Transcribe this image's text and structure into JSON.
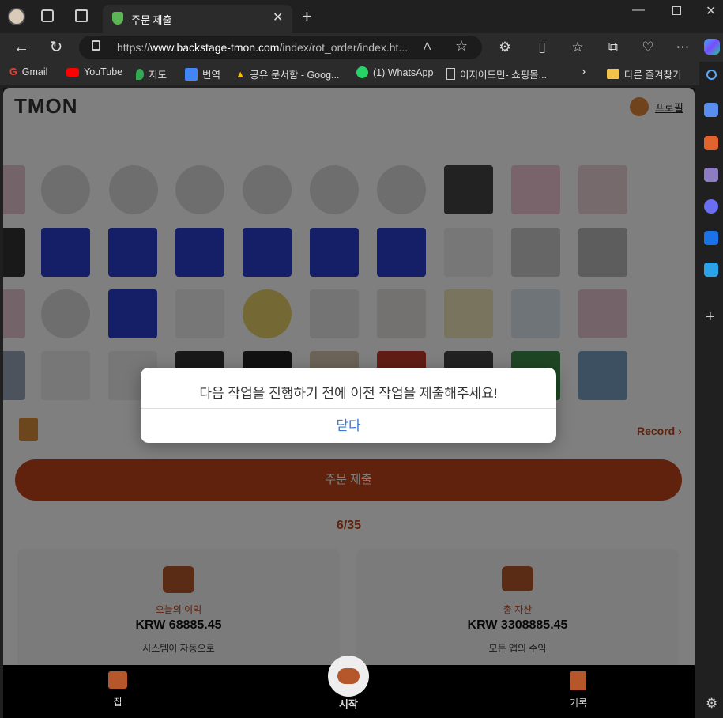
{
  "browser": {
    "tab_title": "주문 제출",
    "url_prefix": "https://",
    "url_domain": "www.backstage-tmon.com",
    "url_path": "/index/rot_order/index.ht...",
    "bookmarks": [
      "Gmail",
      "YouTube",
      "지도",
      "번역",
      "공유 문서함 - Goog...",
      "(1) WhatsApp",
      "이지어드민- 쇼핑몰...",
      "다른 즐겨찾기"
    ]
  },
  "header": {
    "logo": "TMON",
    "profile_label": "프로필"
  },
  "record_label": "Record",
  "submit_button": "주문 제출",
  "progress": "6/35",
  "cards": [
    {
      "title": "오늘의 이익",
      "value": "KRW 68885.45",
      "desc": "시스템이 자동으로"
    },
    {
      "title": "총 자산",
      "value": "KRW 3308885.45",
      "desc": "모든 앱의 수익"
    }
  ],
  "bottom_nav": {
    "home": "집",
    "start": "시작",
    "records": "기록"
  },
  "modal": {
    "message": "다음 작업을 진행하기 전에 이전 작업을 제출해주세요!",
    "close": "닫다"
  },
  "colors": {
    "accent": "#c0441a",
    "brand_text": "#333333",
    "product_blue": "#2b3fd1"
  }
}
